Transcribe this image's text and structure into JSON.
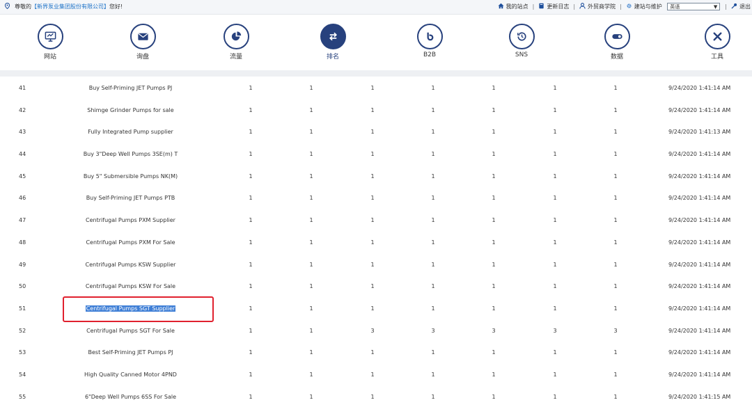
{
  "topbar": {
    "greeting_prefix": "尊敬的",
    "company": "【新界泵业集团股份有限公司】",
    "greeting_suffix": "您好!",
    "links": [
      {
        "label": "我的站点",
        "icon": "home-icon"
      },
      {
        "label": "更新日志",
        "icon": "book-icon"
      },
      {
        "label": "外贸商学院",
        "icon": "user-icon"
      },
      {
        "label": "建站与维护",
        "icon": "gear-icon"
      }
    ],
    "language_value": "英语",
    "logout_label": "退出"
  },
  "nav": [
    {
      "label": "网站",
      "icon": "monitor-icon",
      "active": false
    },
    {
      "label": "询盘",
      "icon": "mail-icon",
      "active": false
    },
    {
      "label": "流量",
      "icon": "pie-chart-icon",
      "active": false
    },
    {
      "label": "排名",
      "icon": "swap-arrows-icon",
      "active": true
    },
    {
      "label": "B2B",
      "icon": "refresh-icon",
      "active": false
    },
    {
      "label": "SNS",
      "icon": "history-icon",
      "active": false
    },
    {
      "label": "数据",
      "icon": "toggle-icon",
      "active": false
    },
    {
      "label": "工具",
      "icon": "tools-icon",
      "active": false
    }
  ],
  "table": {
    "rows": [
      {
        "num": "41",
        "keyword": "Buy Self-Priming JET Pumps PJ",
        "values": [
          "1",
          "1",
          "1",
          "1",
          "1",
          "1",
          "1"
        ],
        "time": "9/24/2020 1:41:14 AM"
      },
      {
        "num": "42",
        "keyword": "Shimge Grinder Pumps for sale",
        "values": [
          "1",
          "1",
          "1",
          "1",
          "1",
          "1",
          "1"
        ],
        "time": "9/24/2020 1:41:14 AM"
      },
      {
        "num": "43",
        "keyword": "Fully Integrated Pump supplier",
        "values": [
          "1",
          "1",
          "1",
          "1",
          "1",
          "1",
          "1"
        ],
        "time": "9/24/2020 1:41:13 AM"
      },
      {
        "num": "44",
        "keyword": "Buy 3\"Deep Well Pumps 3SE(m) T",
        "values": [
          "1",
          "1",
          "1",
          "1",
          "1",
          "1",
          "1"
        ],
        "time": "9/24/2020 1:41:14 AM"
      },
      {
        "num": "45",
        "keyword": "Buy 5\"  Submersible Pumps NK(M)",
        "values": [
          "1",
          "1",
          "1",
          "1",
          "1",
          "1",
          "1"
        ],
        "time": "9/24/2020 1:41:14 AM"
      },
      {
        "num": "46",
        "keyword": "Buy Self-Priming JET Pumps PTB",
        "values": [
          "1",
          "1",
          "1",
          "1",
          "1",
          "1",
          "1"
        ],
        "time": "9/24/2020 1:41:14 AM"
      },
      {
        "num": "47",
        "keyword": "Centrifugal Pumps PXM Supplier",
        "values": [
          "1",
          "1",
          "1",
          "1",
          "1",
          "1",
          "1"
        ],
        "time": "9/24/2020 1:41:14 AM"
      },
      {
        "num": "48",
        "keyword": "Centrifugal Pumps PXM For Sale",
        "values": [
          "1",
          "1",
          "1",
          "1",
          "1",
          "1",
          "1"
        ],
        "time": "9/24/2020 1:41:14 AM"
      },
      {
        "num": "49",
        "keyword": "Centrifugal Pumps KSW Supplier",
        "values": [
          "1",
          "1",
          "1",
          "1",
          "1",
          "1",
          "1"
        ],
        "time": "9/24/2020 1:41:14 AM"
      },
      {
        "num": "50",
        "keyword": "Centrifugal Pumps KSW For Sale",
        "values": [
          "1",
          "1",
          "1",
          "1",
          "1",
          "1",
          "1"
        ],
        "time": "9/24/2020 1:41:14 AM"
      },
      {
        "num": "51",
        "keyword": "Centrifugal Pumps SGT Supplier",
        "values": [
          "1",
          "1",
          "1",
          "1",
          "1",
          "1",
          "1"
        ],
        "time": "9/24/2020 1:41:14 AM",
        "highlighted": true
      },
      {
        "num": "52",
        "keyword": "Centrifugal Pumps SGT For Sale",
        "values": [
          "1",
          "1",
          "3",
          "3",
          "3",
          "3",
          "3"
        ],
        "time": "9/24/2020 1:41:14 AM"
      },
      {
        "num": "53",
        "keyword": "Best Self-Priming JET Pumps PJ",
        "values": [
          "1",
          "1",
          "1",
          "1",
          "1",
          "1",
          "1"
        ],
        "time": "9/24/2020 1:41:14 AM"
      },
      {
        "num": "54",
        "keyword": "High Quality Canned Motor 4PND",
        "values": [
          "1",
          "1",
          "1",
          "1",
          "1",
          "1",
          "1"
        ],
        "time": "9/24/2020 1:41:14 AM"
      },
      {
        "num": "55",
        "keyword": "6\"Deep Well Pumps 6SS For Sale",
        "values": [
          "1",
          "1",
          "1",
          "1",
          "1",
          "1",
          "1"
        ],
        "time": "9/24/2020 1:41:15 AM"
      }
    ]
  }
}
